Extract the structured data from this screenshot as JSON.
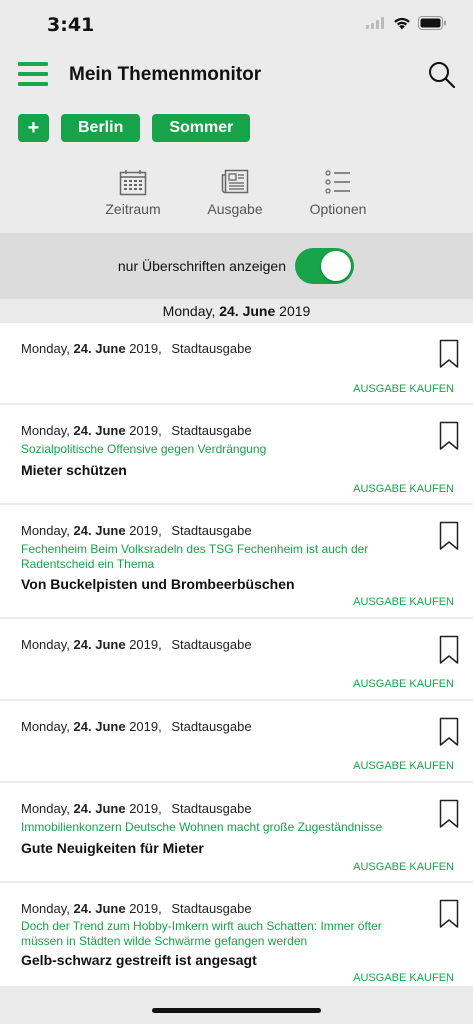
{
  "status_bar": {
    "time": "3:41"
  },
  "header": {
    "title": "Mein Themenmonitor"
  },
  "tags": {
    "add_label": "+",
    "items": [
      "Berlin",
      "Sommer"
    ]
  },
  "toolbar": {
    "zeitraum": "Zeitraum",
    "ausgabe": "Ausgabe",
    "optionen": "Optionen"
  },
  "toggle": {
    "label": "nur Überschriften anzeigen",
    "enabled": true
  },
  "section_date": {
    "weekday": "Monday,",
    "day_month": "24. June",
    "year": "2019"
  },
  "buy_label": "AUSGABE KAUFEN",
  "articles": [
    {
      "weekday": "Monday,",
      "day_month": "24. June",
      "year": "2019,",
      "edition": "Stadtausgabe",
      "kicker": "",
      "headline": ""
    },
    {
      "weekday": "Monday,",
      "day_month": "24. June",
      "year": "2019,",
      "edition": "Stadtausgabe",
      "kicker": "Sozialpolitische Offensive gegen Verdrängung",
      "headline": "Mieter schützen"
    },
    {
      "weekday": "Monday,",
      "day_month": "24. June",
      "year": "2019,",
      "edition": "Stadtausgabe",
      "kicker": "Fechenheim Beim Volksradeln des TSG Fechenheim ist auch der Radentscheid ein Thema",
      "headline": "Von Buckelpisten und Brombeerbüschen"
    },
    {
      "weekday": "Monday,",
      "day_month": "24. June",
      "year": "2019,",
      "edition": "Stadtausgabe",
      "kicker": "",
      "headline": ""
    },
    {
      "weekday": "Monday,",
      "day_month": "24. June",
      "year": "2019,",
      "edition": "Stadtausgabe",
      "kicker": "",
      "headline": ""
    },
    {
      "weekday": "Monday,",
      "day_month": "24. June",
      "year": "2019,",
      "edition": "Stadtausgabe",
      "kicker": "Immobilienkonzern Deutsche Wohnen macht  große Zugeständnisse",
      "headline": "Gute Neuigkeiten für Mieter"
    },
    {
      "weekday": "Monday,",
      "day_month": "24. June",
      "year": "2019,",
      "edition": "Stadtausgabe",
      "kicker": "Doch der Trend zum Hobby-Imkern wirft auch Schatten: Immer öfter müssen in Städten wilde Schwärme gefangen werden",
      "headline": "Gelb-schwarz gestreift ist angesagt"
    }
  ],
  "colors": {
    "accent": "#17a34a",
    "background": "#ebebeb",
    "band": "#dcdcdc"
  }
}
